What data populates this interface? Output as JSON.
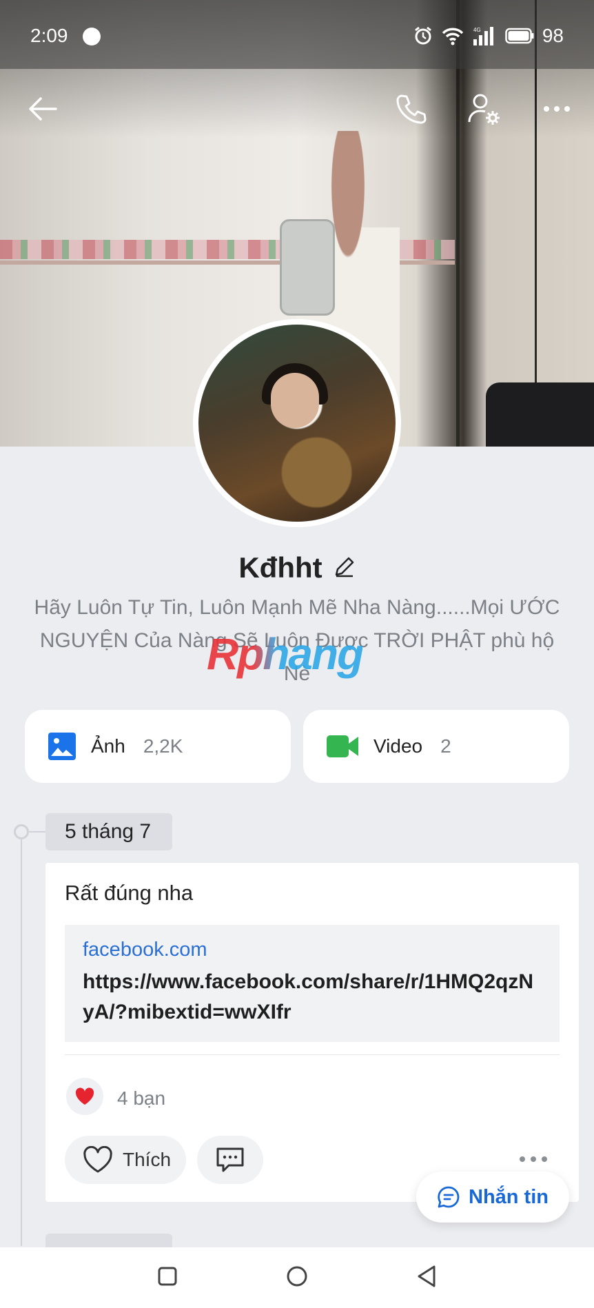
{
  "status_bar": {
    "time": "2:09",
    "network": "4G",
    "battery": "98"
  },
  "header": {
    "back_icon": "arrow-left-icon",
    "call_icon": "phone-icon",
    "settings_icon": "user-settings-icon",
    "more_icon": "more-horizontal-icon"
  },
  "profile": {
    "name": "Kđhht",
    "bio": "Hãy Luôn Tự Tin, Luôn Mạnh Mẽ Nha Nàng......Mọi ƯỚC NGUYỆN Của Nàng Sẽ Luôn Được TRỜI PHẬT phù hộ Nè",
    "watermark": "Rphang"
  },
  "media": {
    "photos": {
      "label": "Ảnh",
      "count": "2,2K",
      "color": "#1a73e8"
    },
    "videos": {
      "label": "Video",
      "count": "2",
      "color": "#34b54f"
    }
  },
  "timeline": {
    "date": "5 tháng 7",
    "post": {
      "text": "Rất đúng nha",
      "link_domain": "facebook.com",
      "link_url": "https://www.facebook.com/share/r/1HMQ2qzNyA/?mibextid=wwXIfr",
      "reaction_count": "4 bạn",
      "like_label": "Thích"
    }
  },
  "message_button": {
    "label": "Nhắn tin",
    "color": "#1868d6"
  }
}
